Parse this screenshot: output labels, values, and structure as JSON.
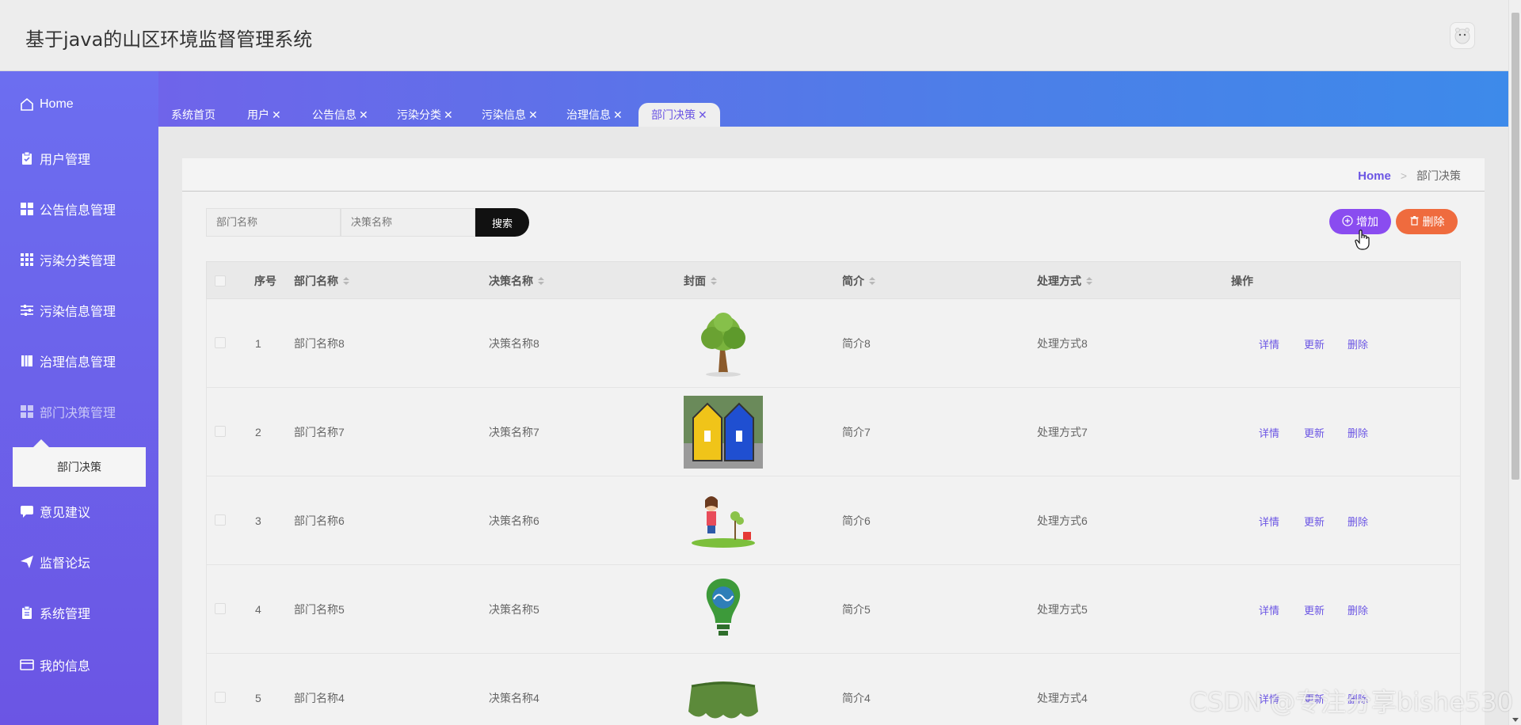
{
  "header": {
    "title": "基于java的山区环境监督管理系统"
  },
  "sidebar": {
    "items": [
      {
        "label": "Home",
        "icon": "home-icon"
      },
      {
        "label": "用户管理",
        "icon": "clipboard-check-icon"
      },
      {
        "label": "公告信息管理",
        "icon": "grid-icon"
      },
      {
        "label": "污染分类管理",
        "icon": "grid-9-icon"
      },
      {
        "label": "污染信息管理",
        "icon": "sliders-icon"
      },
      {
        "label": "治理信息管理",
        "icon": "book-icon"
      },
      {
        "label": "部门决策管理",
        "icon": "grid-icon"
      },
      {
        "label": "意见建议",
        "icon": "chat-icon"
      },
      {
        "label": "监督论坛",
        "icon": "paper-plane-icon"
      },
      {
        "label": "系统管理",
        "icon": "clipboard-icon"
      },
      {
        "label": "我的信息",
        "icon": "card-icon"
      }
    ],
    "submenu": {
      "label": "部门决策"
    }
  },
  "tabs": [
    {
      "label": "系统首页",
      "closable": false
    },
    {
      "label": "用户",
      "closable": true
    },
    {
      "label": "公告信息",
      "closable": true
    },
    {
      "label": "污染分类",
      "closable": true
    },
    {
      "label": "污染信息",
      "closable": true
    },
    {
      "label": "治理信息",
      "closable": true
    },
    {
      "label": "部门决策",
      "closable": true,
      "active": true
    }
  ],
  "breadcrumb": {
    "home": "Home",
    "separator": ">",
    "current": "部门决策"
  },
  "search": {
    "dept_placeholder": "部门名称",
    "decision_placeholder": "决策名称",
    "button": "搜索"
  },
  "actions": {
    "add": "增加",
    "delete": "删除"
  },
  "table": {
    "headers": {
      "index": "序号",
      "dept": "部门名称",
      "decision": "决策名称",
      "cover": "封面",
      "intro": "简介",
      "method": "处理方式",
      "ops": "操作"
    },
    "row_actions": {
      "detail": "详情",
      "update": "更新",
      "delete": "删除"
    },
    "rows": [
      {
        "index": "1",
        "dept": "部门名称8",
        "decision": "决策名称8",
        "cover": "tree",
        "intro": "简介8",
        "method": "处理方式8"
      },
      {
        "index": "2",
        "dept": "部门名称7",
        "decision": "决策名称7",
        "cover": "recycle-bins",
        "intro": "简介7",
        "method": "处理方式7"
      },
      {
        "index": "3",
        "dept": "部门名称6",
        "decision": "决策名称6",
        "cover": "girl-planting",
        "intro": "简介6",
        "method": "处理方式6"
      },
      {
        "index": "4",
        "dept": "部门名称5",
        "decision": "决策名称5",
        "cover": "green-bulb",
        "intro": "简介5",
        "method": "处理方式5"
      },
      {
        "index": "5",
        "dept": "部门名称4",
        "decision": "决策名称4",
        "cover": "leaf-skirt",
        "intro": "简介4",
        "method": "处理方式4"
      }
    ]
  },
  "watermark": "CSDN @专注分享bishe530",
  "colors": {
    "accent": "#6b55e4",
    "add": "#8a4cf0",
    "delete": "#ef6b3e"
  }
}
